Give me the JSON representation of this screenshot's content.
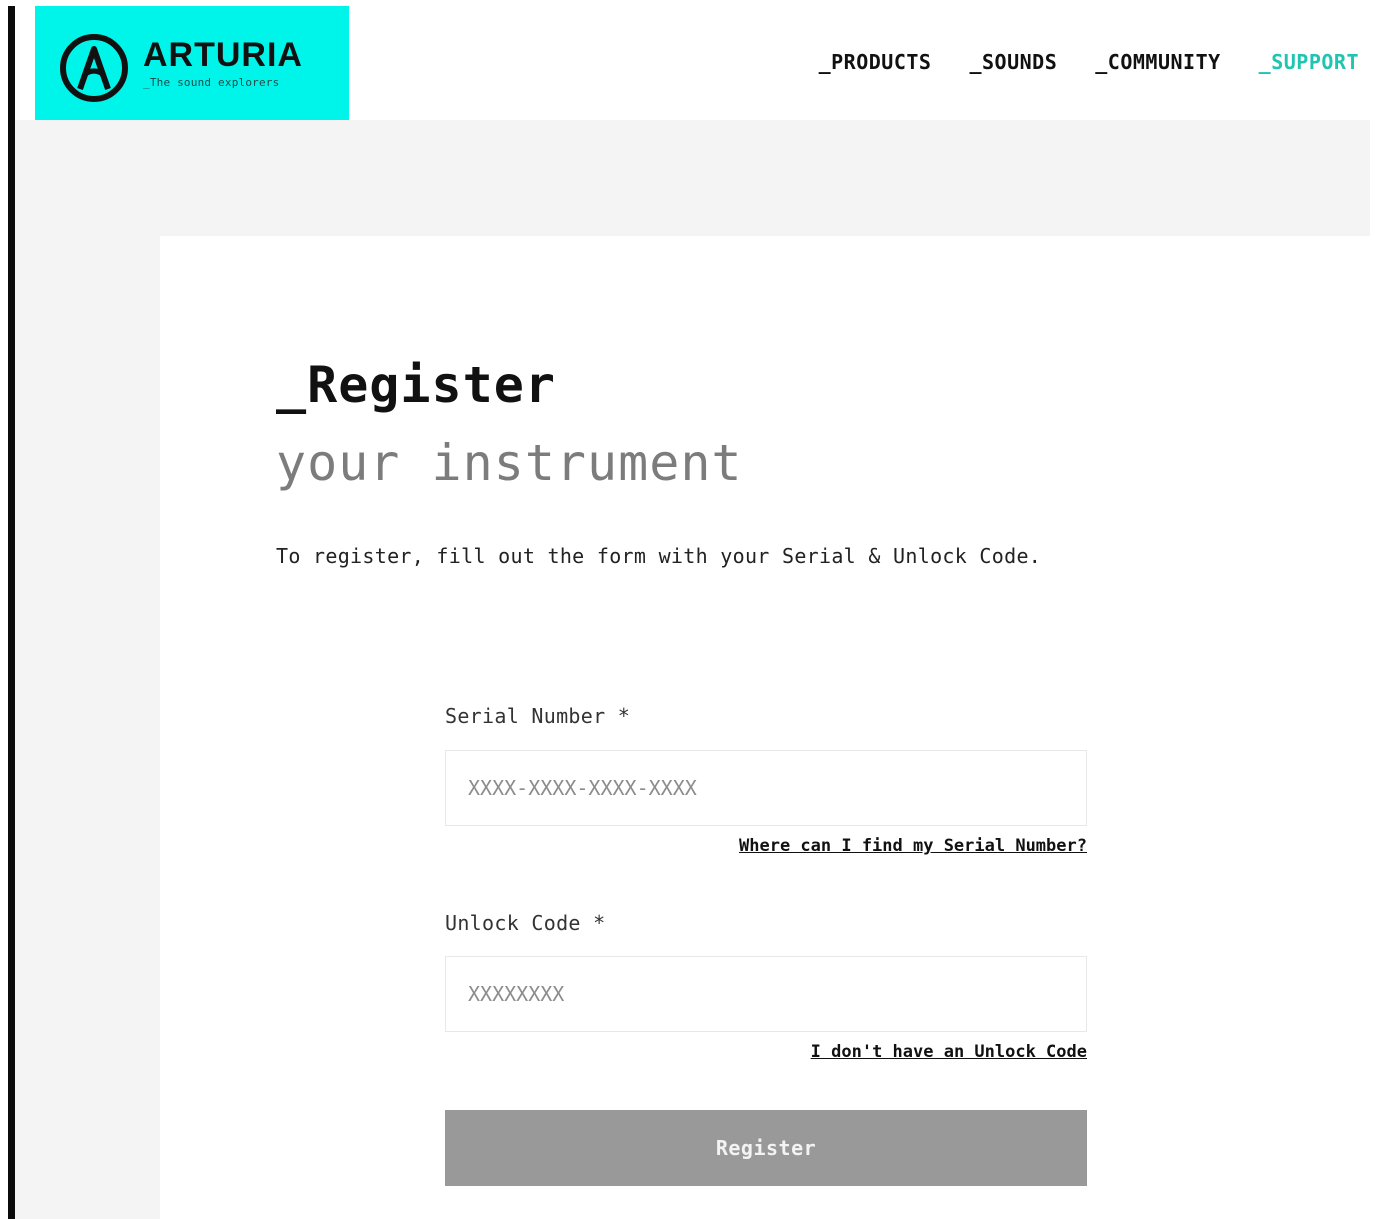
{
  "brand": {
    "name": "ARTURIA",
    "tagline": "_The sound explorers",
    "accent_color": "#00f5ea",
    "logo_icon": "arturia-a-circle-icon"
  },
  "nav": {
    "items": [
      {
        "label": "_PRODUCTS"
      },
      {
        "label": "_SOUNDS"
      },
      {
        "label": "_COMMUNITY"
      },
      {
        "label": "_SUPPORT",
        "active": true
      }
    ],
    "active_color": "#20c5b2"
  },
  "page": {
    "title": "_Register",
    "subtitle": "your instrument",
    "intro": "To register, fill out the form with your Serial & Unlock Code."
  },
  "form": {
    "serial": {
      "label": "Serial Number *",
      "placeholder": "XXXX-XXXX-XXXX-XXXX",
      "value": "",
      "help_link": "Where can I find my Serial Number?"
    },
    "unlock": {
      "label": "Unlock Code *",
      "placeholder": "XXXXXXXX",
      "value": "",
      "help_link": "I don't have an Unlock Code"
    },
    "submit_label": "Register",
    "submit_color": "#999999"
  }
}
